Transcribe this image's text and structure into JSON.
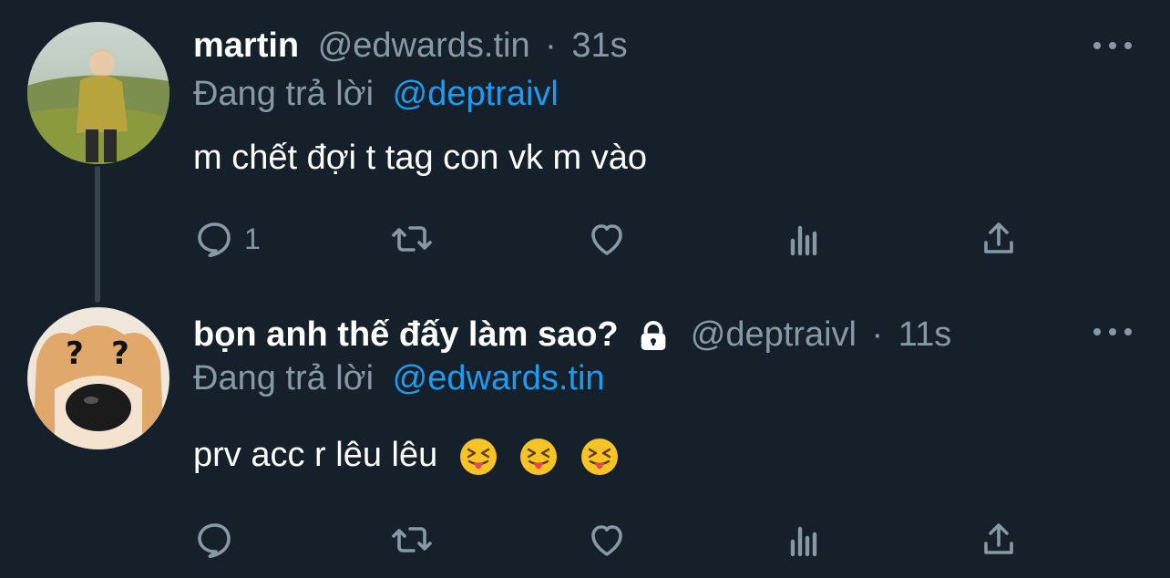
{
  "tweets": [
    {
      "display_name": "martin",
      "handle": "@edwards.tin",
      "separator": "·",
      "time": "31s",
      "reply_prefix": "Đang trả lời",
      "reply_to": "@deptraivl",
      "text": "m chết đợi t tag con vk m vào",
      "reply_count": "1",
      "avatar_icon": "person-photo-avatar"
    },
    {
      "display_name": "bọn anh thế đấy làm sao?",
      "handle": "@deptraivl",
      "separator": "·",
      "time": "11s",
      "reply_prefix": "Đang trả lời",
      "reply_to": "@edwards.tin",
      "text": "prv acc r lêu lêu",
      "reply_count": "",
      "protected_icon": "lock-icon",
      "emojis": [
        "face-with-tongue-squinting",
        "face-with-tongue-squinting",
        "face-with-tongue-squinting"
      ],
      "avatar_icon": "dog-question-marks-avatar"
    }
  ],
  "colors": {
    "background": "#15202b",
    "secondary_text": "#8899a6",
    "link": "#1d9bf0",
    "primary_text": "#ffffff"
  }
}
